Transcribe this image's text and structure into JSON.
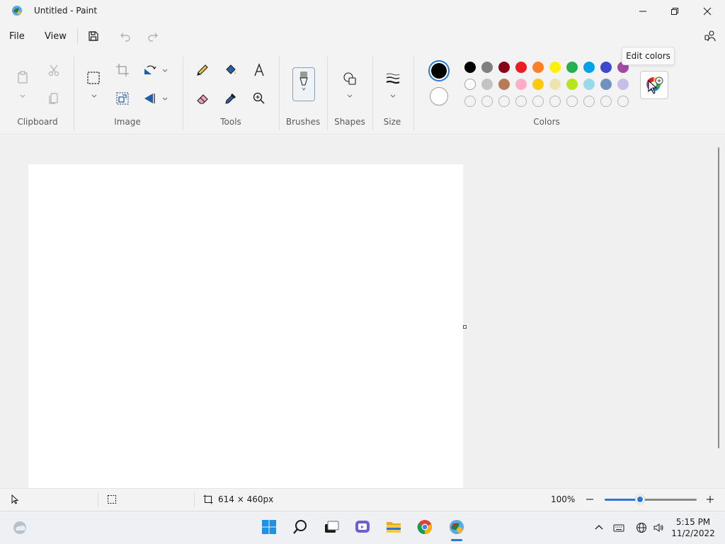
{
  "window": {
    "title": "Untitled - Paint"
  },
  "menu": {
    "file": "File",
    "view": "View"
  },
  "ribbon": {
    "groups": {
      "clipboard": "Clipboard",
      "image": "Image",
      "tools": "Tools",
      "brushes": "Brushes",
      "shapes": "Shapes",
      "size": "Size",
      "colors": "Colors"
    },
    "tooltip": "Edit colors",
    "colors": {
      "primary": "#000000",
      "secondary": "#ffffff",
      "row1": [
        "#000000",
        "#7f7f7f",
        "#880015",
        "#ed1c24",
        "#ff7f27",
        "#fff200",
        "#22b14c",
        "#00a2e8",
        "#3f48cc",
        "#a349a4"
      ],
      "row2": [
        "#ffffff",
        "#c3c3c3",
        "#b97a57",
        "#ffaec9",
        "#ffc90e",
        "#efe4b0",
        "#b5e61d",
        "#99d9ea",
        "#7092be",
        "#c8bfe7"
      ]
    }
  },
  "status": {
    "canvas_size": "614 × 460px",
    "zoom": "100%",
    "zoom_fraction": 0.38
  },
  "taskbar": {
    "time": "5:15 PM",
    "date": "11/2/2022"
  }
}
